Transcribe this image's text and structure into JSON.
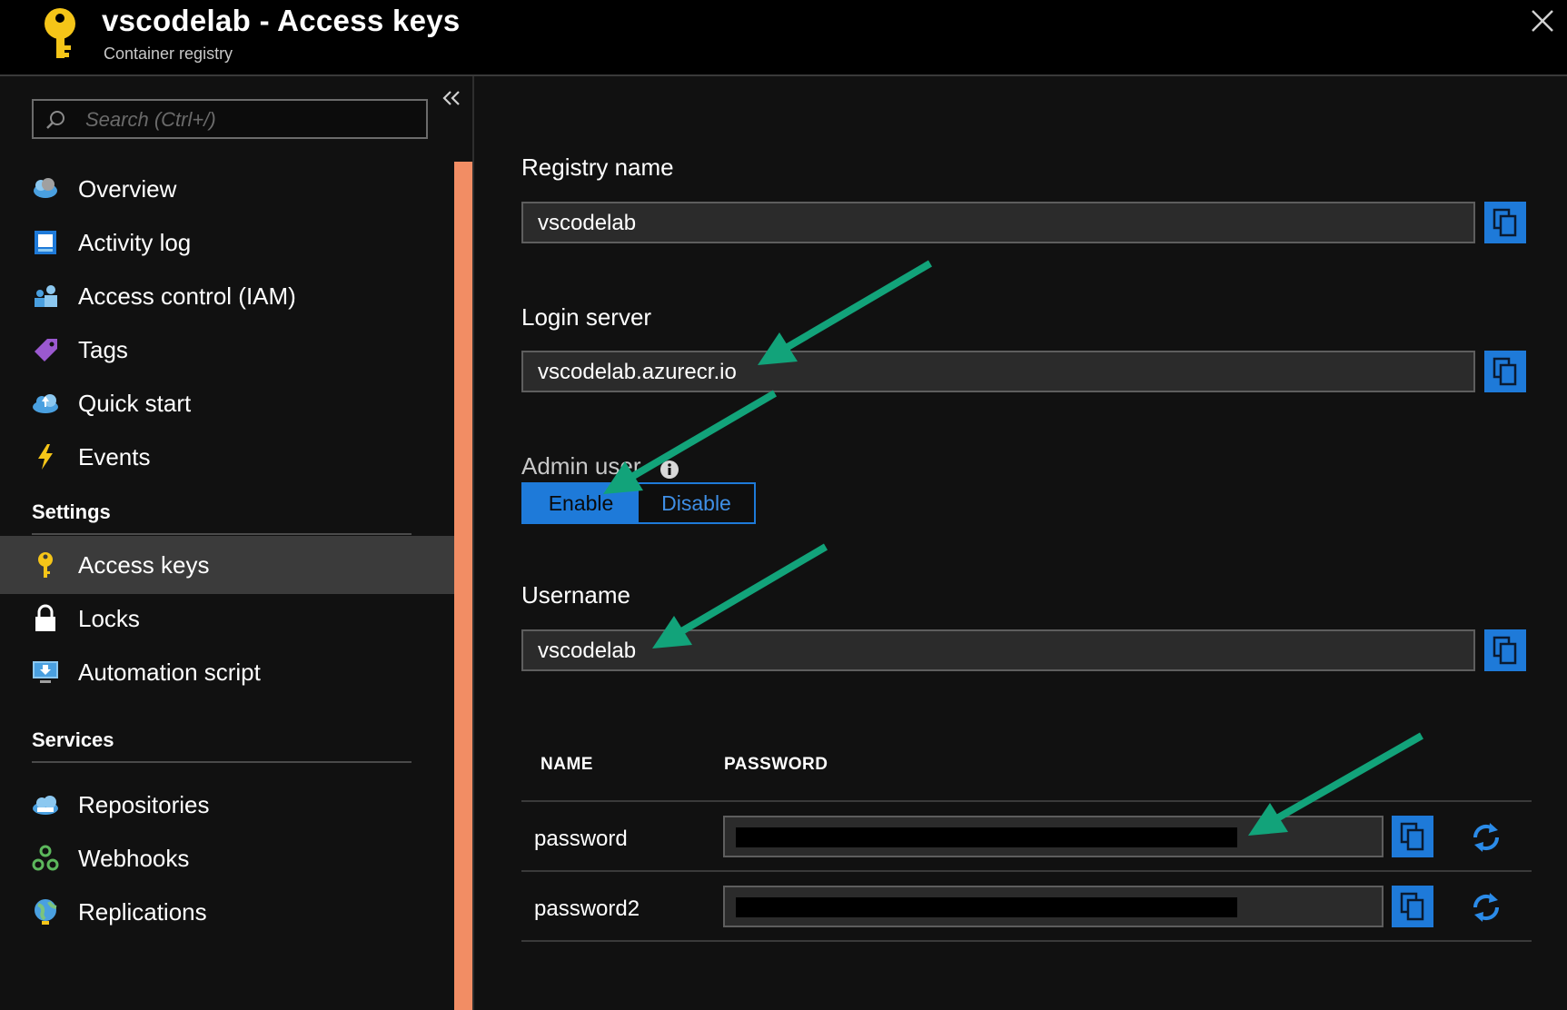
{
  "header": {
    "title": "vscodelab - Access keys",
    "subtitle": "Container registry",
    "logo_icon": "key-icon",
    "close_icon": "close-icon"
  },
  "sidebar": {
    "search_placeholder": "Search (Ctrl+/)",
    "collapse_icon": "double-chevron-left-icon",
    "items": [
      {
        "label": "Overview",
        "icon": "cloud-overview-icon"
      },
      {
        "label": "Activity log",
        "icon": "activity-log-icon"
      },
      {
        "label": "Access control (IAM)",
        "icon": "people-icon"
      },
      {
        "label": "Tags",
        "icon": "tag-icon"
      },
      {
        "label": "Quick start",
        "icon": "cloud-quickstart-icon"
      },
      {
        "label": "Events",
        "icon": "lightning-icon"
      }
    ],
    "settings": {
      "title": "Settings",
      "items": [
        {
          "label": "Access keys",
          "icon": "key-icon",
          "active": true
        },
        {
          "label": "Locks",
          "icon": "lock-icon"
        },
        {
          "label": "Automation script",
          "icon": "monitor-download-icon"
        }
      ]
    },
    "services": {
      "title": "Services",
      "items": [
        {
          "label": "Repositories",
          "icon": "cloud-repo-icon"
        },
        {
          "label": "Webhooks",
          "icon": "webhook-icon"
        },
        {
          "label": "Replications",
          "icon": "globe-icon"
        }
      ]
    }
  },
  "main": {
    "registry_name": {
      "label": "Registry name",
      "value": "vscodelab"
    },
    "login_server": {
      "label": "Login server",
      "value": "vscodelab.azurecr.io"
    },
    "admin_user": {
      "label": "Admin user",
      "enable": "Enable",
      "disable": "Disable",
      "selected": "Enable"
    },
    "username": {
      "label": "Username",
      "value": "vscodelab"
    },
    "passwords": {
      "col_name": "NAME",
      "col_password": "PASSWORD",
      "rows": [
        {
          "name": "password"
        },
        {
          "name": "password2"
        }
      ]
    }
  },
  "colors": {
    "accent": "#1e7ad9",
    "scrollbar": "#f28d64",
    "annotation_arrow": "#12a37a"
  }
}
